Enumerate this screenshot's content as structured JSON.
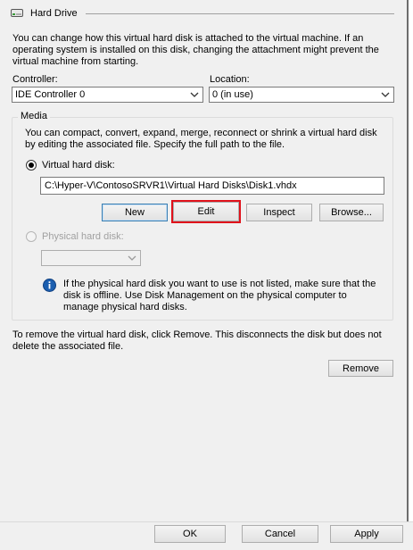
{
  "header": {
    "title": "Hard Drive"
  },
  "description": "You can change how this virtual hard disk is attached to the virtual machine. If an operating system is installed on this disk, changing the attachment might prevent the virtual machine from starting.",
  "controller": {
    "label": "Controller:",
    "value": "IDE Controller 0"
  },
  "location": {
    "label": "Location:",
    "value": "0 (in use)"
  },
  "media": {
    "group_label": "Media",
    "description": "You can compact, convert, expand, merge, reconnect or shrink a virtual hard disk by editing the associated file. Specify the full path to the file.",
    "virtual_disk": {
      "label": "Virtual hard disk:",
      "selected": true,
      "path": "C:\\Hyper-V\\ContosoSRVR1\\Virtual Hard Disks\\Disk1.vhdx"
    },
    "buttons": {
      "new": "New",
      "edit": "Edit",
      "inspect": "Inspect",
      "browse": "Browse..."
    },
    "physical_disk": {
      "label": "Physical hard disk:",
      "selected": false,
      "enabled": false,
      "value": ""
    },
    "info_text": "If the physical hard disk you want to use is not listed, make sure that the disk is offline. Use Disk Management on the physical computer to manage physical hard disks."
  },
  "remove": {
    "text": "To remove the virtual hard disk, click Remove. This disconnects the disk but does not delete the associated file.",
    "button": "Remove"
  },
  "footer": {
    "ok": "OK",
    "cancel": "Cancel",
    "apply": "Apply"
  },
  "colors": {
    "highlight_outline": "#e0121b",
    "info_icon": "#1c5fb0"
  }
}
